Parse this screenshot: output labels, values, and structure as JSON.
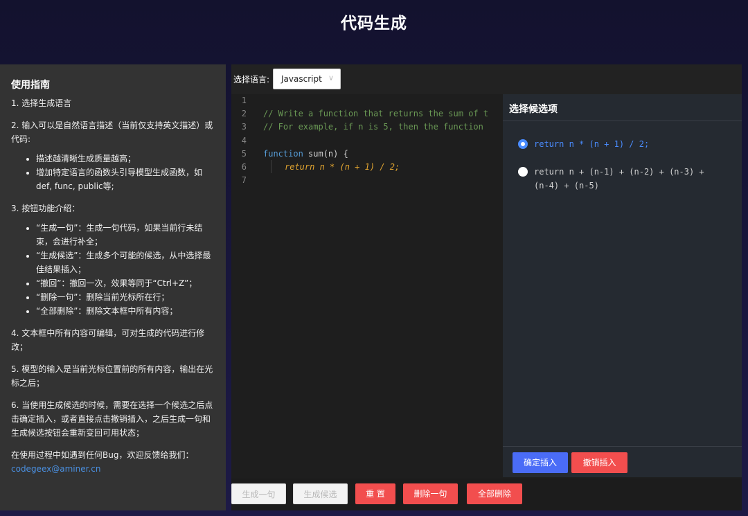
{
  "header": {
    "title": "代码生成"
  },
  "guide": {
    "title": "使用指南",
    "step1": "1. 选择生成语言",
    "step2": "2. 输入可以是自然语言描述（当前仅支持英文描述）或代码:",
    "step2_bullets": [
      "描述越清晰生成质量越高；",
      "增加特定语言的函数头引导模型生成函数，如def, func, public等;"
    ],
    "step3": "3. 按钮功能介绍：",
    "step3_bullets": [
      "“生成一句”：生成一句代码，如果当前行未结束，会进行补全；",
      "“生成候选”：生成多个可能的候选，从中选择最佳结果插入；",
      "“撤回”：撤回一次，效果等同于“Ctrl+Z”；",
      "“删除一句”：删除当前光标所在行；",
      "“全部删除”：删除文本框中所有内容；"
    ],
    "step4": "4. 文本框中所有内容可编辑，可对生成的代码进行修改；",
    "step5": "5. 模型的输入是当前光标位置前的所有内容，输出在光标之后；",
    "step6": "6. 当使用生成候选的时候，需要在选择一个候选之后点击确定插入，或者直接点击撤销插入，之后生成一句和生成候选按钮会重新变回可用状态；",
    "feedback": "在使用过程中如遇到任何Bug，欢迎反馈给我们：",
    "email": "codegeex@aminer.cn"
  },
  "language": {
    "label": "选择语言:",
    "selected": "Javascript"
  },
  "editor": {
    "line_numbers": [
      "1",
      "2",
      "3",
      "4",
      "5",
      "6",
      "7"
    ],
    "line2": "// Write a function that returns the sum of t",
    "line3": "// For example, if n is 5, then the function ",
    "line5_keyword": "function",
    "line5_rest": " sum(n) {",
    "line6": "return n * (n + 1) / 2;"
  },
  "candidates": {
    "title": "选择候选项",
    "options": [
      {
        "line1": "return n * (n + 1) / 2;",
        "line2": "",
        "selected": true
      },
      {
        "line1": "return n + (n-1) + (n-2) + (n-3) +",
        "line2": "(n-4) + (n-5)",
        "selected": false
      }
    ],
    "confirm_label": "确定插入",
    "cancel_label": "撤销插入"
  },
  "toolbar": {
    "gen_line_label": "生成一句",
    "gen_candidates_label": "生成候选",
    "reset_label": "重 置",
    "delete_line_label": "删除一句",
    "delete_all_label": "全部删除"
  },
  "colors": {
    "accent_blue": "#4a6cf7",
    "danger_red": "#f24e4e",
    "selected_option": "#4a8cff"
  }
}
